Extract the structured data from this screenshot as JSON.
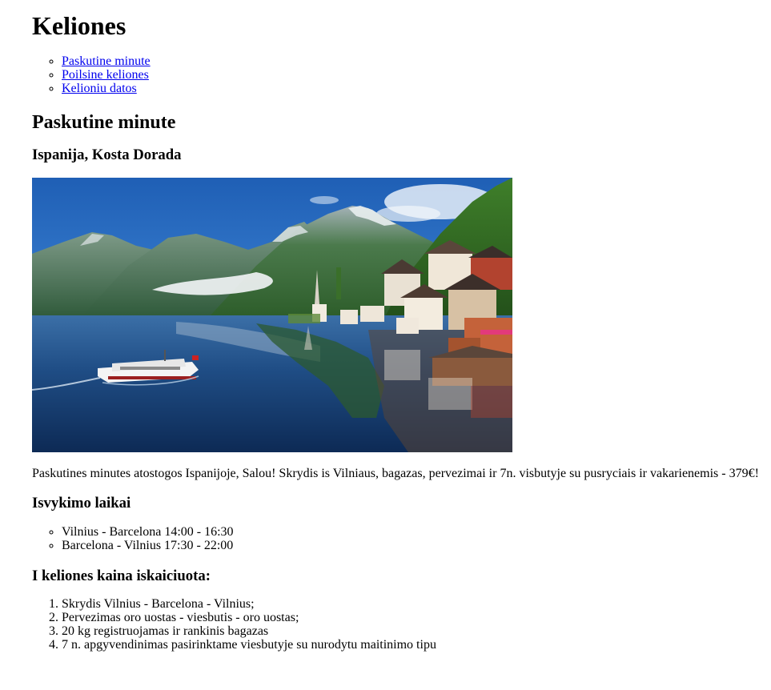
{
  "page_title": "Keliones",
  "nav": {
    "items": [
      {
        "label": "Paskutine minute"
      },
      {
        "label": "Poilsine keliones"
      },
      {
        "label": "Kelioniu datos"
      }
    ]
  },
  "section": {
    "title": "Paskutine minute",
    "destination": "Ispanija, Kosta Dorada",
    "image": {
      "description": "hallstatt-lake-village-photo"
    },
    "description": "Paskutines minutes atostogos Ispanijoje, Salou! Skrydis is Vilniaus, bagazas, pervezimai ir 7n. visbutyje su pusryciais ir vakarienemis - 379€!",
    "departure_times": {
      "title": "Isvykimo laikai",
      "items": [
        "Vilnius - Barcelona 14:00 - 16:30",
        "Barcelona - Vilnius 17:30 - 22:00"
      ]
    },
    "price_includes": {
      "title": "I keliones kaina iskaiciuota:",
      "items": [
        "Skrydis Vilnius - Barcelona - Vilnius;",
        "Pervezimas oro uostas - viesbutis - oro uostas;",
        "20 kg registruojamas ir rankinis bagazas",
        "7 n. apgyvendinimas pasirinktame viesbutyje su nurodytu maitinimo tipu"
      ]
    }
  },
  "colors": {
    "link": "#0000ee",
    "text": "#000000",
    "background": "#ffffff"
  }
}
